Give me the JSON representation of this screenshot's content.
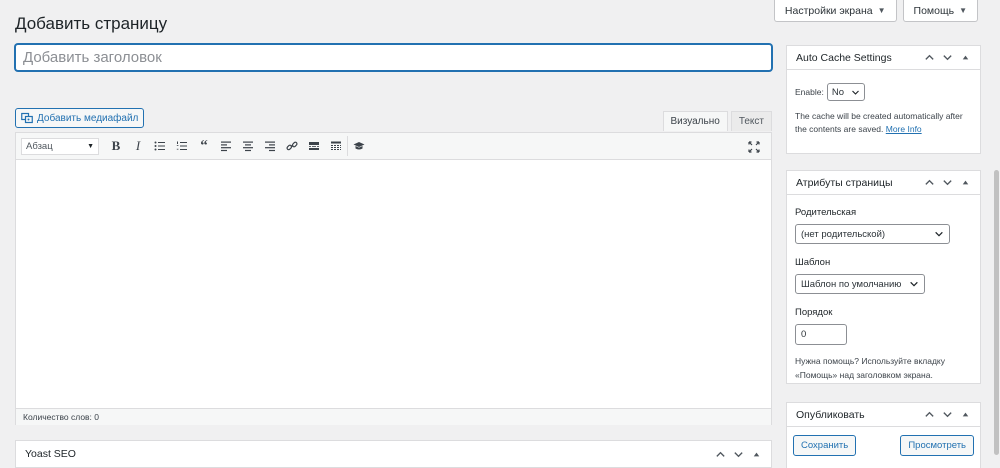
{
  "screen_meta": {
    "screen_options_label": "Настройки экрана",
    "help_label": "Помощь"
  },
  "page": {
    "title": "Добавить страницу"
  },
  "title_field": {
    "placeholder": "Добавить заголовок"
  },
  "editor": {
    "add_media_label": "Добавить медиафайл",
    "tab_visual": "Визуально",
    "tab_text": "Текст",
    "format_select_value": "Абзац",
    "toolbar_icons": [
      "bold-icon",
      "italic-icon",
      "bullet-list-icon",
      "numbered-list-icon",
      "blockquote-icon",
      "align-left-icon",
      "align-center-icon",
      "align-right-icon",
      "link-icon",
      "read-more-icon",
      "toolbar-toggle-icon",
      "graduation-cap-icon",
      "fullscreen-icon"
    ],
    "word_count": "Количество слов: 0"
  },
  "yoast": {
    "title": "Yoast SEO"
  },
  "auto_cache": {
    "title": "Auto Cache Settings",
    "enable_label": "Enable:",
    "enable_value": "No",
    "description": "The cache will be created automatically after the contents are saved.",
    "more_info": "More Info"
  },
  "page_attributes": {
    "title": "Атрибуты страницы",
    "parent_label": "Родительская",
    "parent_value": "(нет родительской)",
    "template_label": "Шаблон",
    "template_value": "Шаблон по умолчанию",
    "order_label": "Порядок",
    "order_value": "0",
    "help_text": "Нужна помощь? Используйте вкладку «Помощь» над заголовком экрана."
  },
  "publish": {
    "title": "Опубликовать",
    "save_label": "Сохранить",
    "preview_label": "Просмотреть"
  },
  "colors": {
    "accent": "#2271b1",
    "background": "#f0f0f1",
    "panel_border": "#dcdcde"
  }
}
